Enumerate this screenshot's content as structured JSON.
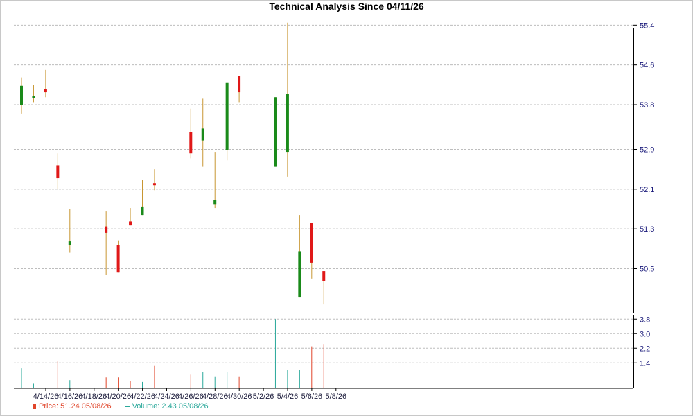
{
  "chart_data": {
    "type": "candlestick",
    "title": "Technical Analysis Since 04/11/26",
    "price_axis": {
      "ylim": [
        49.6,
        55.6
      ],
      "ticks": [
        "55.4",
        "54.6",
        "53.8",
        "52.9",
        "52.1",
        "51.3",
        "50.5"
      ],
      "tick_values": [
        55.4,
        54.6,
        53.8,
        52.9,
        52.1,
        51.3,
        50.5
      ]
    },
    "volume_axis": {
      "ylim": [
        0,
        4.0
      ],
      "ticks": [
        "3.8",
        "3.0",
        "2.2",
        "1.4"
      ],
      "tick_values": [
        3.8,
        3.0,
        2.2,
        1.4
      ]
    },
    "x_labels": [
      "4/14/26",
      "4/16/26",
      "4/18/26",
      "4/20/26",
      "4/22/26",
      "4/24/26",
      "4/26/26",
      "4/28/26",
      "4/30/26",
      "5/2/26",
      "5/4/26",
      "5/6/26",
      "5/8/26"
    ],
    "candles": [
      {
        "date": "4/13/26",
        "open": 53.8,
        "close": 54.18,
        "high": 54.35,
        "low": 53.62,
        "volume": 1.1
      },
      {
        "date": "4/14/26",
        "open": 53.95,
        "close": 53.98,
        "high": 54.2,
        "low": 53.85,
        "volume": 0.25
      },
      {
        "date": "4/15/26",
        "open": 54.12,
        "close": 54.05,
        "high": 54.5,
        "low": 53.95,
        "volume": 0
      },
      {
        "date": "4/16/26",
        "open": 52.58,
        "close": 52.32,
        "high": 52.82,
        "low": 52.1,
        "volume": 1.5
      },
      {
        "date": "4/17/26",
        "open": 50.98,
        "close": 51.05,
        "high": 51.7,
        "low": 50.82,
        "volume": 0.45
      },
      {
        "date": "4/20/26",
        "open": 51.35,
        "close": 51.22,
        "high": 51.65,
        "low": 50.38,
        "volume": 0.6
      },
      {
        "date": "4/21/26",
        "open": 50.98,
        "close": 50.42,
        "high": 51.07,
        "low": 50.42,
        "volume": 0.6
      },
      {
        "date": "4/22/26",
        "open": 51.45,
        "close": 51.37,
        "high": 51.72,
        "low": 51.37,
        "volume": 0.4
      },
      {
        "date": "4/23/26",
        "open": 51.58,
        "close": 51.75,
        "high": 52.28,
        "low": 51.58,
        "volume": 0.35
      },
      {
        "date": "4/24/26",
        "open": 52.22,
        "close": 52.18,
        "high": 52.5,
        "low": 52.08,
        "volume": 1.23
      },
      {
        "date": "4/27/26",
        "open": 53.25,
        "close": 52.82,
        "high": 53.72,
        "low": 52.72,
        "volume": 0.75
      },
      {
        "date": "4/28/26",
        "open": 53.08,
        "close": 53.32,
        "high": 53.92,
        "low": 52.55,
        "volume": 0.9
      },
      {
        "date": "4/29/26",
        "open": 51.8,
        "close": 51.88,
        "high": 52.85,
        "low": 51.72,
        "volume": 0.62
      },
      {
        "date": "4/30/26",
        "open": 52.88,
        "close": 54.25,
        "high": 54.25,
        "low": 52.68,
        "volume": 0.88
      },
      {
        "date": "5/1/26",
        "open": 54.38,
        "close": 54.05,
        "high": 54.38,
        "low": 53.85,
        "volume": 0.62
      },
      {
        "date": "5/4/26",
        "open": 52.55,
        "close": 53.95,
        "high": 53.95,
        "low": 52.55,
        "volume": 3.8
      },
      {
        "date": "5/5/26",
        "open": 52.85,
        "close": 54.02,
        "high": 55.45,
        "low": 52.35,
        "volume": 1.0
      },
      {
        "date": "5/6/26",
        "open": 49.92,
        "close": 50.85,
        "high": 51.58,
        "low": 49.92,
        "volume": 1.0
      },
      {
        "date": "5/7/26",
        "open": 51.42,
        "close": 50.62,
        "high": 51.42,
        "low": 50.3,
        "volume": 2.3
      },
      {
        "date": "5/8/26",
        "open": 50.45,
        "close": 50.25,
        "high": 50.45,
        "low": 49.78,
        "volume": 2.43
      }
    ],
    "colors": {
      "up": "#1a8a1a",
      "down": "#e01818",
      "wick": "#c89632",
      "vol_up": "#2aa89a",
      "vol_down": "#e0452a",
      "grid": "#bdbdbd",
      "axis": "#000000"
    }
  },
  "legend": {
    "price": "Price: 51.24  05/08/26",
    "volume": "Volume: 2.43  05/08/26"
  }
}
